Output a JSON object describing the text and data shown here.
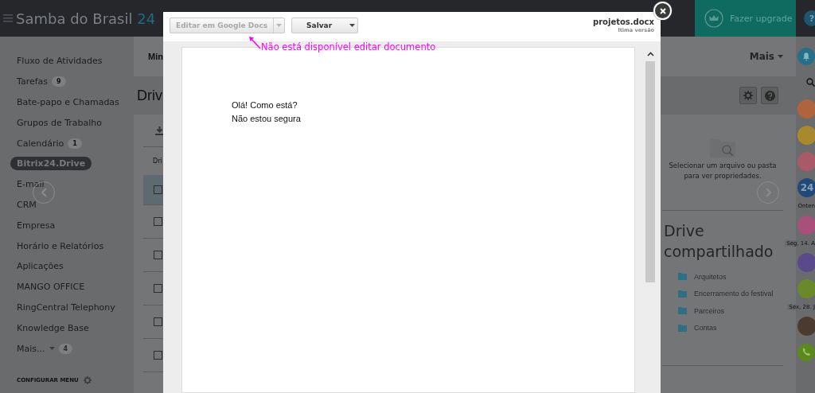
{
  "header": {
    "brand": "Samba do Brasil",
    "brand_suffix": "24",
    "upgrade_button": "Fazer upgrade",
    "help_button": "?"
  },
  "sidebar": {
    "items": [
      {
        "label": "Fluxo de Atividades",
        "selected": false
      },
      {
        "label": "Tarefas",
        "counter": "9",
        "selected": false
      },
      {
        "label": "Bate-papo e Chamadas",
        "selected": false
      },
      {
        "label": "Grupos de Trabalho",
        "selected": false
      },
      {
        "label": "Calendário",
        "counter": "1",
        "selected": false
      },
      {
        "label": "Bitrix24.Drive",
        "selected": true
      },
      {
        "label": "E-mail",
        "selected": false
      },
      {
        "label": "CRM",
        "selected": false
      },
      {
        "label": "Empresa",
        "selected": false
      },
      {
        "label": "Horário e Relatórios",
        "selected": false
      },
      {
        "label": "Aplicações",
        "selected": false
      },
      {
        "label": "MANGO OFFICE",
        "selected": false
      },
      {
        "label": "RingCentral Telephony",
        "selected": false
      },
      {
        "label": "Knowledge Base",
        "selected": false
      },
      {
        "label": "Mais...",
        "counter": "4",
        "kind": "more",
        "selected": false
      }
    ],
    "configure": "CONFIGURAR MENU"
  },
  "main": {
    "nav_left": "Min",
    "nav_more": "Mais",
    "title": "Driv",
    "column_header": "Dri",
    "file_rows": [
      {
        "selected": true,
        "checked": false
      },
      {
        "selected": false,
        "checked": false
      },
      {
        "selected": false,
        "checked": false
      },
      {
        "selected": false,
        "checked": false
      },
      {
        "selected": false,
        "checked": false
      },
      {
        "selected": false,
        "checked": false
      }
    ],
    "empty_state": "Selecionar um arquivo ou pasta para ver propriedades.",
    "shared_title": "Drive compartilhado",
    "shared_folders": [
      "Arquitetos",
      "Encerramento do festival",
      "Parceiros",
      "Contas"
    ]
  },
  "right_strip": [
    {
      "kind": "bell"
    },
    {
      "kind": "search"
    },
    {
      "kind": "avatar",
      "color": "#b0643c"
    },
    {
      "kind": "avatar",
      "color": "#a88a2c"
    },
    {
      "kind": "avatar",
      "color": "#a85a68"
    },
    {
      "kind": "avatar",
      "color": "#1f4a78",
      "text": "24"
    },
    {
      "kind": "date",
      "text": "Onten"
    },
    {
      "kind": "avatar",
      "color": "#a8507a"
    },
    {
      "kind": "date",
      "text": "Seg, 14. A"
    },
    {
      "kind": "avatar",
      "color": "#5a4a8a"
    },
    {
      "kind": "avatar",
      "color": "#6a8a2a"
    },
    {
      "kind": "date",
      "text": "Sex, 28. J"
    },
    {
      "kind": "avatar",
      "color": "#4a3a30"
    },
    {
      "kind": "phone"
    }
  ],
  "modal": {
    "filename": "projetos.docx",
    "version_note": "ltima versão",
    "buttons": [
      {
        "label": "Editar em Google Docs",
        "disabled": true
      },
      {
        "label": "Salvar",
        "disabled": false
      }
    ],
    "annotation": "Não está disponível editar documento",
    "document_lines": [
      "Olá! Como está?",
      "Não estou segura"
    ]
  }
}
